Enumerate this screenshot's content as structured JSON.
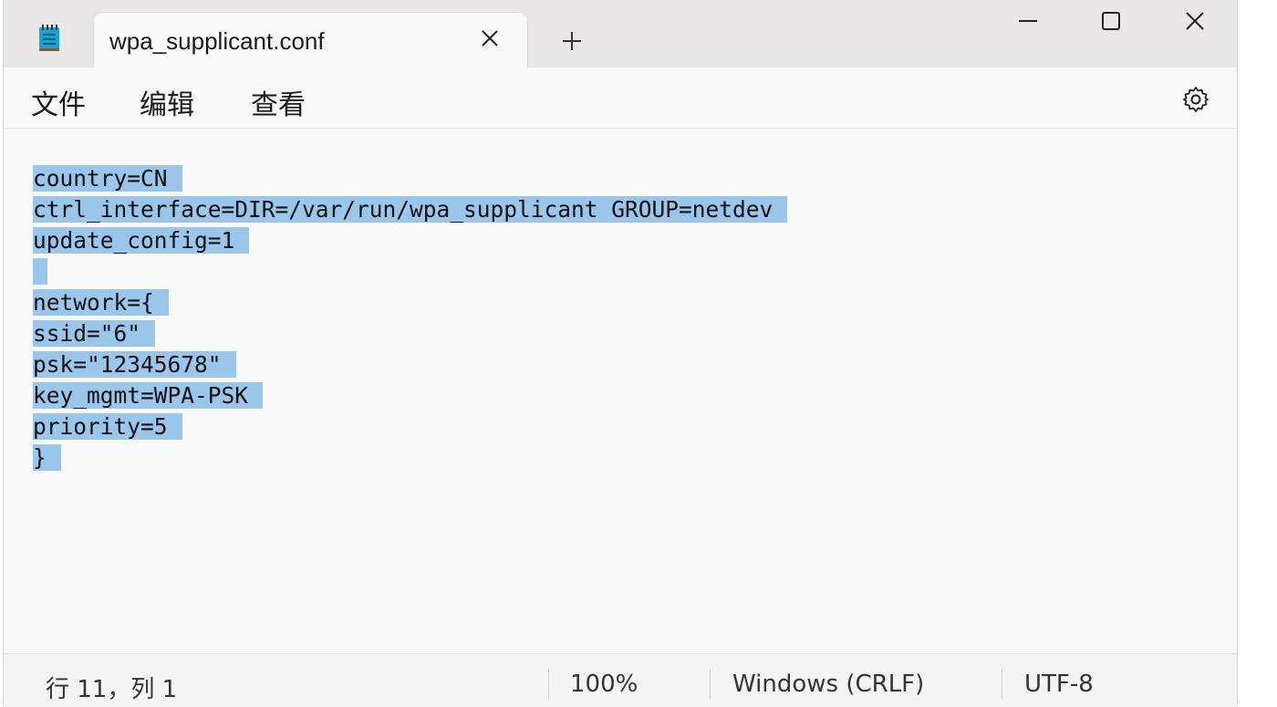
{
  "app": {
    "tab_title": "wpa_supplicant.conf"
  },
  "icons": {
    "app": "notepad-icon",
    "tab_close": "close-icon",
    "new_tab": "plus-icon",
    "minimize": "minimize-icon",
    "maximize": "maximize-icon",
    "close": "close-icon",
    "settings": "gear-icon"
  },
  "menu": {
    "file": "文件",
    "edit": "编辑",
    "view": "查看"
  },
  "editor": {
    "lines": [
      "country=CN",
      "ctrl_interface=DIR=/var/run/wpa_supplicant GROUP=netdev",
      "update_config=1",
      "",
      "network={",
      "ssid=\"6\"",
      "psk=\"12345678\"",
      "key_mgmt=WPA-PSK",
      "priority=5",
      "}"
    ],
    "selection_color": "#9ac6ec"
  },
  "status": {
    "position": "行 11，列 1",
    "zoom": "100%",
    "line_ending": "Windows (CRLF)",
    "encoding": "UTF-8"
  }
}
